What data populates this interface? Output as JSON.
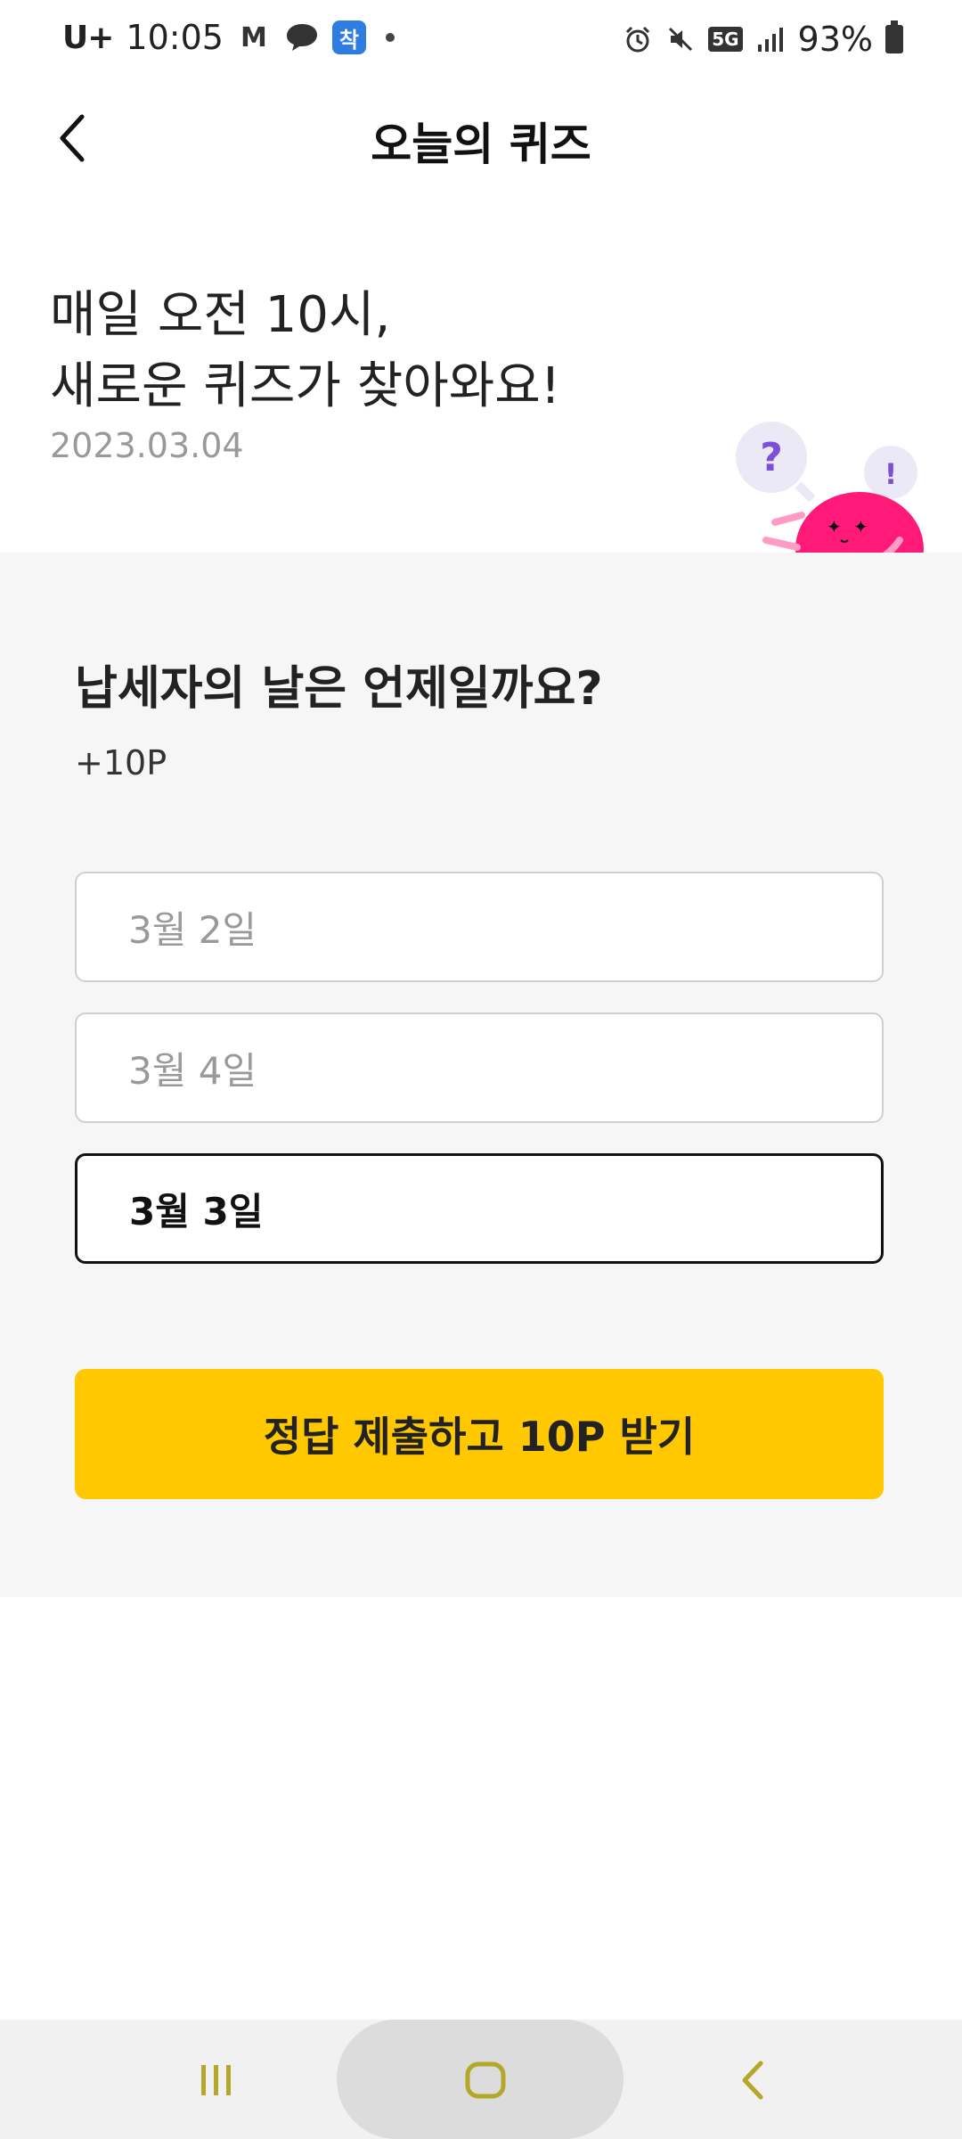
{
  "status_bar": {
    "carrier": "U+",
    "time": "10:05",
    "notification_icons": [
      "gmail-icon",
      "talk-icon",
      "app-icon-blue",
      "dot-icon"
    ],
    "app_icon_blue_text": "착",
    "fiveg_label": "5G",
    "battery": "93%"
  },
  "header": {
    "title": "오늘의 퀴즈"
  },
  "hero": {
    "headline": "매일 오전 10시,\n새로운 퀴즈가 찾아와요!",
    "date": "2023.03.04",
    "mascot_bubble_q": "?",
    "mascot_bubble_e": "!",
    "accent_color": "#ff1a7a",
    "bubble_color": "#7b4fd6"
  },
  "quiz": {
    "question": "납세자의 날은 언제일까요?",
    "points": "+10P",
    "options": [
      {
        "label": "3월 2일",
        "selected": false
      },
      {
        "label": "3월 4일",
        "selected": false
      },
      {
        "label": "3월 3일",
        "selected": true
      }
    ],
    "submit_label": "정답 제출하고 10P 받기",
    "submit_color": "#ffc800"
  },
  "nav_bar": {
    "icons": [
      "recent-apps-icon",
      "home-icon",
      "back-icon"
    ],
    "icon_color": "#b5a72a"
  }
}
